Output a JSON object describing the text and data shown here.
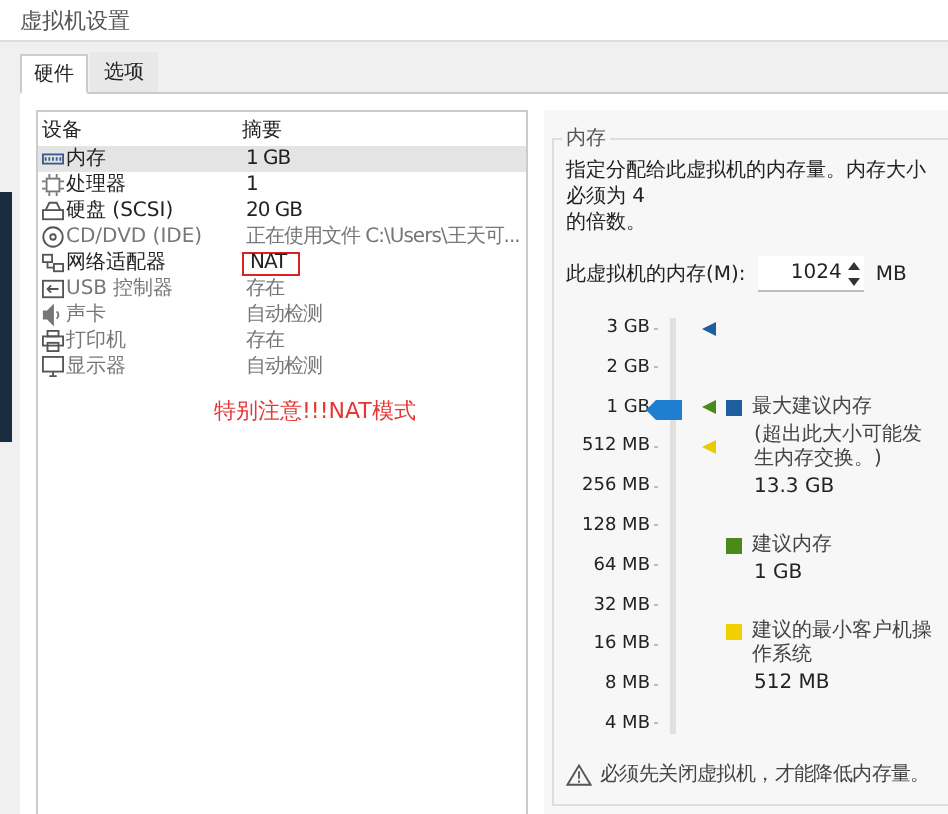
{
  "window": {
    "title": "虚拟机设置"
  },
  "tabs": [
    {
      "label": "硬件",
      "selected": true
    },
    {
      "label": "选项",
      "selected": false
    }
  ],
  "devices": {
    "columns": [
      "设备",
      "摘要"
    ],
    "rows": [
      {
        "kind": "memory",
        "name": "内存",
        "summary": "1 GB",
        "selected": true,
        "highlighted": false,
        "dimmed": false
      },
      {
        "kind": "cpu",
        "name": "处理器",
        "summary": "1",
        "selected": false,
        "highlighted": false,
        "dimmed": false
      },
      {
        "kind": "disk",
        "name": "硬盘 (SCSI)",
        "summary": "20 GB",
        "selected": false,
        "highlighted": false,
        "dimmed": false
      },
      {
        "kind": "cd",
        "name": "CD/DVD (IDE)",
        "summary": "正在使用文件 C:\\Users\\王天可...",
        "selected": false,
        "highlighted": false,
        "dimmed": true
      },
      {
        "kind": "network",
        "name": "网络适配器",
        "summary": "NAT",
        "selected": false,
        "highlighted": true,
        "dimmed": false
      },
      {
        "kind": "usb",
        "name": "USB 控制器",
        "summary": "存在",
        "selected": false,
        "highlighted": false,
        "dimmed": true
      },
      {
        "kind": "sound",
        "name": "声卡",
        "summary": "自动检测",
        "selected": false,
        "highlighted": false,
        "dimmed": true
      },
      {
        "kind": "printer",
        "name": "打印机",
        "summary": "存在",
        "selected": false,
        "highlighted": false,
        "dimmed": true
      },
      {
        "kind": "display",
        "name": "显示器",
        "summary": "自动检测",
        "selected": false,
        "highlighted": false,
        "dimmed": true
      }
    ],
    "annotation": "特别注意!!!NAT模式"
  },
  "memory": {
    "title": "内存",
    "description": "指定分配给此虚拟机的内存量。内存大小必须为 4",
    "description_line2": "的倍数。",
    "field_label": "此虚拟机的内存(M):",
    "value": "1024",
    "unit": "MB",
    "slider": {
      "level": 0.778,
      "ticks": [
        {
          "label": "3 GB",
          "color": "#1f5fa0"
        },
        {
          "label": "2 GB"
        },
        {
          "label": "1 GB",
          "color": "#4a8a1a"
        },
        {
          "label": "512 MB",
          "color": "#e6cc00"
        },
        {
          "label": "256 MB"
        },
        {
          "label": "128 MB"
        },
        {
          "label": "64 MB"
        },
        {
          "label": "32 MB"
        },
        {
          "label": "16 MB"
        },
        {
          "label": "8 MB"
        },
        {
          "label": "4 MB"
        }
      ]
    },
    "legend": [
      {
        "color": "#1f5fa0",
        "label": "最大建议内存",
        "note": "(超出此大小可能发生内存交换。)",
        "value": "13.3 GB"
      },
      {
        "color": "#4a8a1a",
        "label": "建议内存",
        "value": "1 GB"
      },
      {
        "color": "#f0d000",
        "label": "建议的最小客户机操作系统",
        "value": "512 MB"
      }
    ],
    "warning": "必须先关闭虚拟机，才能降低内存量。"
  }
}
